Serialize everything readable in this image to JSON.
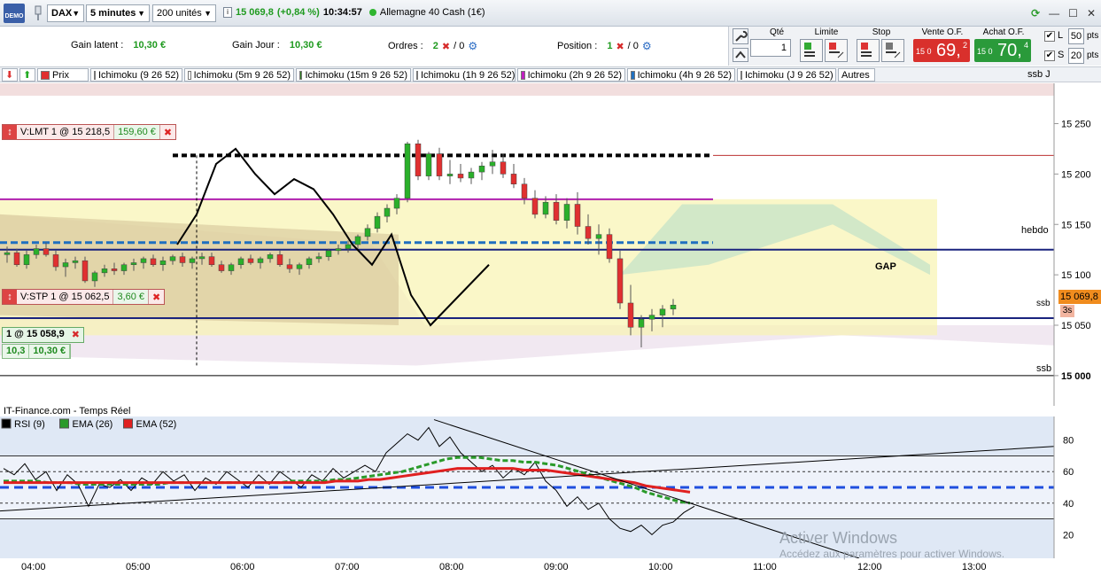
{
  "toolbar": {
    "demo_label": "DEMO",
    "instrument": "DAX",
    "timeframe": "5 minutes",
    "units": "200 unités",
    "price": "15 069,8",
    "change": "(+0,84 %)",
    "time": "10:34:57",
    "market": "Allemagne 40 Cash (1€)"
  },
  "info": {
    "gain_latent_label": "Gain latent :",
    "gain_latent": "10,30 €",
    "gain_jour_label": "Gain Jour :",
    "gain_jour": "10,30 €",
    "ordres_label": "Ordres :",
    "ordres_count": "2",
    "ordres_zero": "/ 0",
    "position_label": "Position :",
    "position_count": "1",
    "position_zero": "/ 0"
  },
  "trade": {
    "qte_label": "Qté",
    "qte_value": "1",
    "limite_label": "Limite",
    "stop_label": "Stop",
    "sell_label": "Vente O.F.",
    "sell_prefix": "15 0",
    "sell_big": "69,",
    "sell_sup": "2",
    "buy_label": "Achat O.F.",
    "buy_prefix": "15 0",
    "buy_big": "70,",
    "buy_sup": "4",
    "l_label": "L",
    "l_value": "50",
    "s_label": "S",
    "s_value": "20",
    "pts": "pts",
    "colors": {
      "sell": "#d9302c",
      "buy": "#2a9a3a"
    }
  },
  "legend": [
    {
      "label": "Prix",
      "color": "#e03030"
    },
    {
      "label": "Ichimoku (9 26 52)",
      "color": "#1f4fbf"
    },
    {
      "label": "Ichimoku (5m 9 26 52)",
      "color": "#ffffff"
    },
    {
      "label": "Ichimoku (15m 9 26 52)",
      "color": "#2f7f1f"
    },
    {
      "label": "Ichimoku (1h 9 26 52)",
      "color": "#3aa0a0"
    },
    {
      "label": "Ichimoku (2h 9 26 52)",
      "color": "#c020c0"
    },
    {
      "label": "Ichimoku (4h 9 26 52)",
      "color": "#1f6fbf"
    },
    {
      "label": "Ichimoku (J 9 26 52)",
      "color": "#000000"
    },
    {
      "label": "Autres",
      "color": ""
    }
  ],
  "orders": {
    "lmt_label": "V:LMT  1 @ 15 218,5",
    "lmt_value": "159,60 €",
    "stp_label": "V:STP  1 @ 15 062,5",
    "stp_value": "3,60 €",
    "position": "1 @ 15 058,9",
    "pos_pts": "10,3",
    "pos_eur": "10,30 €"
  },
  "annotations": {
    "gap": "GAP",
    "hebdo": "hebdo",
    "ssb": "ssb",
    "ssb_j": "ssb J",
    "source": "IT-Finance.com - Temps Réel",
    "current_price": "15 069,8",
    "sec": "3s"
  },
  "rsi_legend": [
    {
      "label": "RSI (9)",
      "color": "#000000"
    },
    {
      "label": "EMA (26)",
      "color": "#2a9a2a"
    },
    {
      "label": "EMA (52)",
      "color": "#e02020"
    }
  ],
  "watermark": {
    "line1": "Activer Windows",
    "line2": "Accédez aux paramètres pour activer Windows."
  },
  "chart_data": [
    {
      "type": "line",
      "title": "DAX 5 minutes",
      "ylim": [
        14970,
        15290
      ],
      "y_ticks": [
        "15 250",
        "15 200",
        "15 150",
        "15 100",
        "15 050",
        "15 000"
      ],
      "y_tick_values": [
        15250,
        15200,
        15150,
        15100,
        15050,
        15000
      ],
      "x_ticks": [
        "04:00",
        "05:00",
        "06:00",
        "07:00",
        "08:00",
        "09:00",
        "10:00",
        "11:00",
        "12:00",
        "13:00"
      ],
      "horizontal_levels": [
        {
          "name": "V:LMT",
          "value": 15218.5,
          "color": "#000000"
        },
        {
          "name": "hebdo",
          "value": 15125,
          "color": "#1a237e"
        },
        {
          "name": "V:STP",
          "value": 15062.5,
          "color": "#999999"
        },
        {
          "name": "ssb",
          "value": 15057,
          "color": "#1a237e"
        },
        {
          "name": "ssb",
          "value": 15000,
          "color": "#000000"
        }
      ],
      "candles_ohlc": [
        [
          15120,
          15128,
          15112,
          15122
        ],
        [
          15122,
          15126,
          15108,
          15110
        ],
        [
          15110,
          15124,
          15106,
          15120
        ],
        [
          15120,
          15130,
          15116,
          15126
        ],
        [
          15126,
          15132,
          15118,
          15120
        ],
        [
          15120,
          15124,
          15104,
          15108
        ],
        [
          15108,
          15116,
          15098,
          15112
        ],
        [
          15112,
          15118,
          15106,
          15114
        ],
        [
          15114,
          15118,
          15092,
          15094
        ],
        [
          15094,
          15104,
          15088,
          15102
        ],
        [
          15102,
          15110,
          15098,
          15106
        ],
        [
          15106,
          15112,
          15100,
          15104
        ],
        [
          15104,
          15112,
          15100,
          15110
        ],
        [
          15110,
          15116,
          15104,
          15112
        ],
        [
          15112,
          15118,
          15106,
          15116
        ],
        [
          15116,
          15120,
          15108,
          15110
        ],
        [
          15110,
          15118,
          15104,
          15114
        ],
        [
          15114,
          15120,
          15110,
          15118
        ],
        [
          15118,
          15122,
          15108,
          15112
        ],
        [
          15112,
          15118,
          15106,
          15116
        ],
        [
          15116,
          15122,
          15110,
          15118
        ],
        [
          15118,
          15122,
          15108,
          15110
        ],
        [
          15110,
          15114,
          15102,
          15104
        ],
        [
          15104,
          15112,
          15100,
          15110
        ],
        [
          15110,
          15118,
          15106,
          15116
        ],
        [
          15116,
          15120,
          15110,
          15112
        ],
        [
          15112,
          15118,
          15106,
          15116
        ],
        [
          15116,
          15122,
          15112,
          15120
        ],
        [
          15120,
          15124,
          15108,
          15110
        ],
        [
          15110,
          15116,
          15102,
          15106
        ],
        [
          15106,
          15112,
          15100,
          15110
        ],
        [
          15110,
          15118,
          15106,
          15116
        ],
        [
          15116,
          15122,
          15112,
          15118
        ],
        [
          15118,
          15126,
          15114,
          15124
        ],
        [
          15124,
          15130,
          15120,
          15126
        ],
        [
          15126,
          15134,
          15122,
          15130
        ],
        [
          15130,
          15140,
          15126,
          15138
        ],
        [
          15138,
          15150,
          15134,
          15146
        ],
        [
          15146,
          15162,
          15142,
          15158
        ],
        [
          15158,
          15170,
          15152,
          15166
        ],
        [
          15166,
          15180,
          15160,
          15176
        ],
        [
          15176,
          15232,
          15172,
          15230
        ],
        [
          15230,
          15234,
          15194,
          15198
        ],
        [
          15198,
          15222,
          15194,
          15220
        ],
        [
          15220,
          15226,
          15194,
          15198
        ],
        [
          15198,
          15214,
          15190,
          15200
        ],
        [
          15200,
          15210,
          15192,
          15196
        ],
        [
          15196,
          15206,
          15190,
          15202
        ],
        [
          15202,
          15212,
          15194,
          15208
        ],
        [
          15208,
          15224,
          15200,
          15212
        ],
        [
          15212,
          15220,
          15196,
          15200
        ],
        [
          15200,
          15210,
          15186,
          15190
        ],
        [
          15190,
          15196,
          15170,
          15176
        ],
        [
          15176,
          15184,
          15156,
          15160
        ],
        [
          15160,
          15178,
          15156,
          15172
        ],
        [
          15172,
          15180,
          15150,
          15154
        ],
        [
          15154,
          15176,
          15146,
          15170
        ],
        [
          15170,
          15182,
          15140,
          15148
        ],
        [
          15148,
          15160,
          15130,
          15136
        ],
        [
          15136,
          15150,
          15120,
          15140
        ],
        [
          15140,
          15146,
          15112,
          15116
        ],
        [
          15116,
          15124,
          15066,
          15072
        ],
        [
          15072,
          15090,
          15040,
          15048
        ],
        [
          15048,
          15060,
          15028,
          15056
        ],
        [
          15056,
          15066,
          15044,
          15060
        ],
        [
          15060,
          15070,
          15048,
          15066
        ],
        [
          15066,
          15076,
          15060,
          15070
        ]
      ]
    },
    {
      "type": "line",
      "title": "RSI",
      "ylim": [
        5,
        95
      ],
      "y_ticks": [
        "80",
        "60",
        "40",
        "20"
      ],
      "y_tick_values": [
        80,
        60,
        40,
        20
      ],
      "series": [
        {
          "name": "RSI (9)",
          "color": "#000000",
          "values": [
            62,
            58,
            65,
            55,
            60,
            48,
            58,
            52,
            38,
            52,
            50,
            55,
            48,
            56,
            52,
            60,
            54,
            58,
            48,
            56,
            52,
            60,
            55,
            50,
            58,
            52,
            60,
            55,
            50,
            58,
            54,
            62,
            56,
            60,
            64,
            60,
            72,
            78,
            84,
            80,
            88,
            76,
            82,
            72,
            66,
            60,
            64,
            56,
            62,
            58,
            66,
            54,
            48,
            38,
            44,
            36,
            40,
            30,
            24,
            22,
            26,
            20,
            26,
            28,
            34,
            38
          ]
        },
        {
          "name": "EMA (26)",
          "color": "#2a9a2a",
          "values": [
            54,
            54,
            54,
            54,
            53,
            53,
            53,
            52,
            52,
            52,
            52,
            52,
            52,
            52,
            52,
            53,
            53,
            53,
            53,
            53,
            53,
            53,
            53,
            53,
            53,
            53,
            54,
            54,
            54,
            54,
            55,
            55,
            56,
            57,
            58,
            59,
            60,
            62,
            64,
            66,
            68,
            69,
            69,
            69,
            68,
            67,
            67,
            66,
            66,
            65,
            64,
            62,
            60,
            58,
            56,
            54,
            52,
            50,
            47,
            45,
            43,
            41,
            40
          ]
        },
        {
          "name": "EMA (52)",
          "color": "#e02020",
          "values": [
            53,
            53,
            53,
            53,
            53,
            53,
            53,
            53,
            53,
            53,
            53,
            53,
            53,
            53,
            53,
            53,
            53,
            53,
            53,
            53,
            53,
            53,
            53,
            53,
            53,
            53,
            53,
            53,
            53,
            53,
            54,
            54,
            54,
            55,
            55,
            56,
            57,
            58,
            59,
            60,
            61,
            62,
            62,
            62,
            62,
            62,
            62,
            61,
            61,
            61,
            60,
            59,
            58,
            57,
            56,
            55,
            54,
            53,
            51,
            50,
            49,
            48,
            47
          ]
        }
      ],
      "horizontal_levels": [
        70,
        60,
        50,
        40,
        30
      ]
    }
  ]
}
